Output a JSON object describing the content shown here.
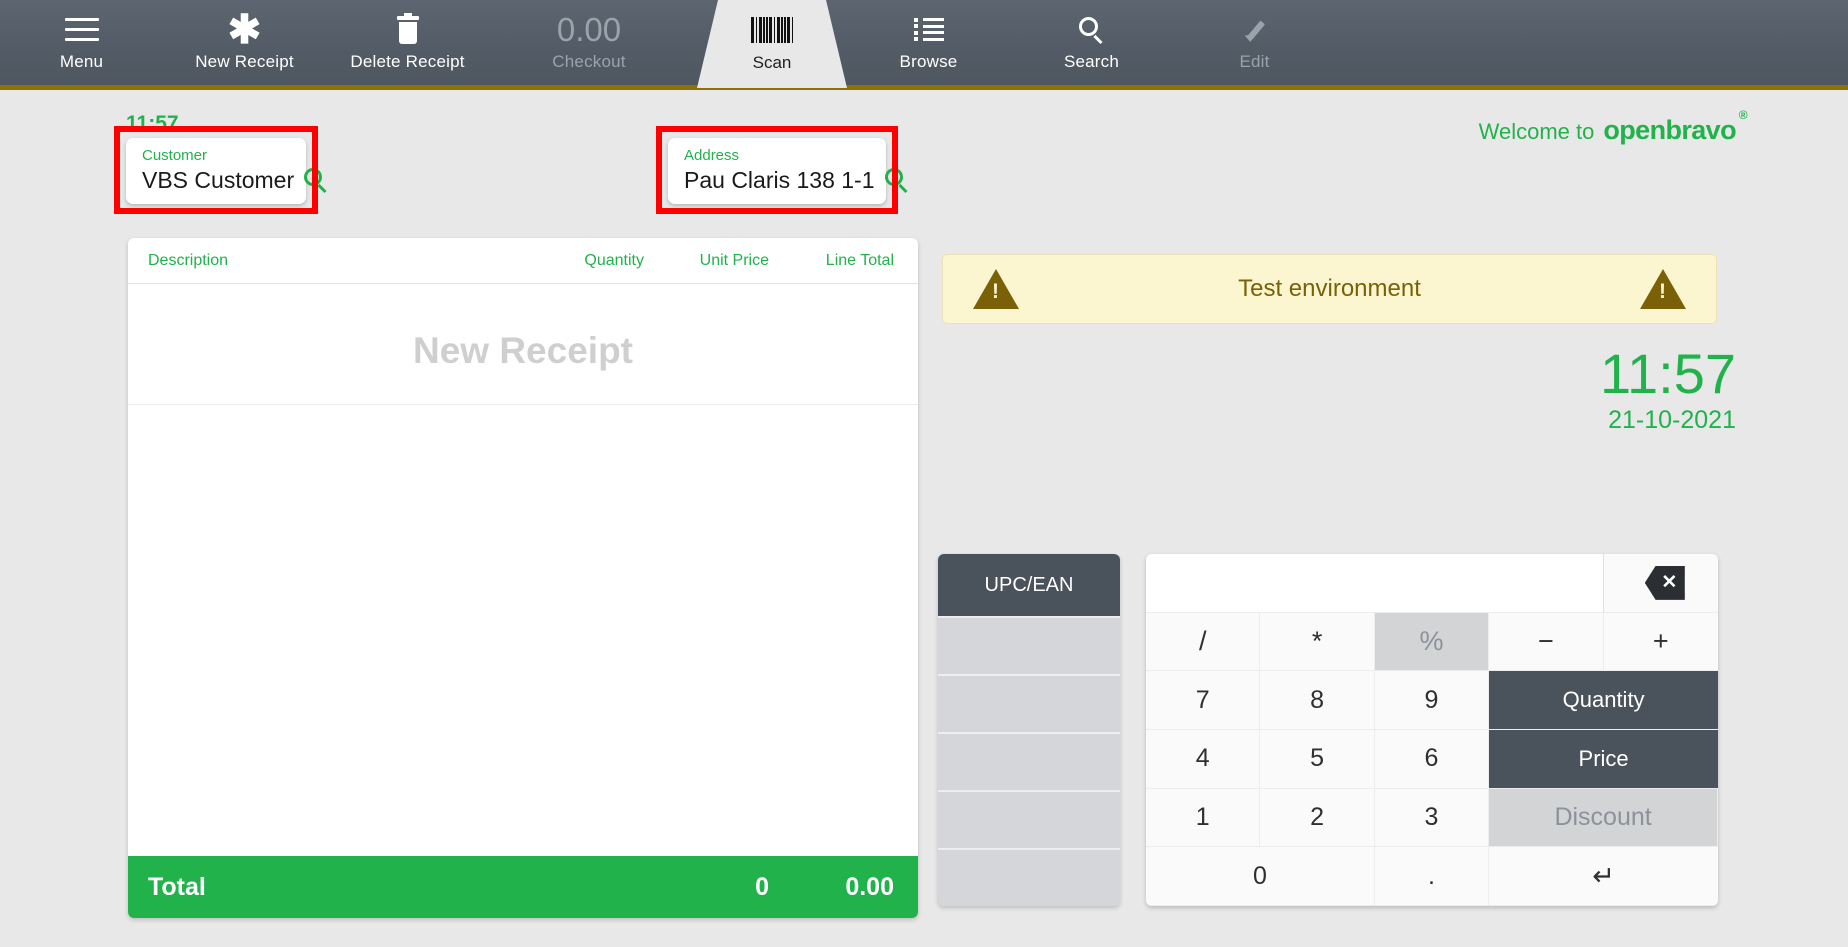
{
  "toolbar": {
    "items": [
      {
        "label": "Menu",
        "icon": "hamburger-menu-icon",
        "disabled": false
      },
      {
        "label": "New Receipt",
        "icon": "asterisk-icon",
        "disabled": false
      },
      {
        "label": "Delete Receipt",
        "icon": "trash-icon",
        "disabled": false
      },
      {
        "label": "Checkout",
        "icon": "amount-display",
        "amount": "0.00",
        "disabled": true
      },
      {
        "label": "Scan",
        "icon": "barcode-icon",
        "active": true
      },
      {
        "label": "Browse",
        "icon": "list-icon",
        "disabled": false
      },
      {
        "label": "Search",
        "icon": "magnifier-icon",
        "disabled": false
      },
      {
        "label": "Edit",
        "icon": "pencil-icon",
        "disabled": true
      }
    ],
    "checkout_amount": "0.00"
  },
  "status": {
    "time_small": "11:57"
  },
  "customer_field": {
    "label": "Customer",
    "value": "VBS Customer",
    "icon": "magnifier-icon"
  },
  "address_field": {
    "label": "Address",
    "value": "Pau Claris 138 1-1",
    "icon": "magnifier-icon"
  },
  "receipt": {
    "columns": {
      "description": "Description",
      "quantity": "Quantity",
      "unit_price": "Unit Price",
      "line_total": "Line Total"
    },
    "placeholder": "New Receipt",
    "total": {
      "label": "Total",
      "quantity": "0",
      "amount": "0.00"
    }
  },
  "branding": {
    "welcome_text": "Welcome to",
    "brand_name": "openbravo",
    "trademark": "®"
  },
  "banner": {
    "text": "Test environment",
    "icon": "warning-triangle-icon"
  },
  "clock": {
    "time": "11:57",
    "date": "21-10-2021"
  },
  "scan_panel": {
    "header": "UPC/EAN",
    "slots": [
      "",
      "",
      "",
      "",
      ""
    ]
  },
  "keypad": {
    "display_value": "",
    "backspace_icon": "backspace-icon",
    "keys": {
      "divide": "/",
      "multiply": "*",
      "percent": "%",
      "minus": "−",
      "plus": "+",
      "seven": "7",
      "eight": "8",
      "nine": "9",
      "four": "4",
      "five": "5",
      "six": "6",
      "one": "1",
      "two": "2",
      "three": "3",
      "zero": "0",
      "dot": ".",
      "enter": "↵",
      "quantity": "Quantity",
      "price": "Price",
      "discount": "Discount"
    }
  },
  "colors": {
    "accent_green": "#22b24c",
    "toolbar": "#535c66",
    "gold_line": "#8d7208",
    "dark_key": "#4a525b",
    "banner_bg": "#fbf6d0",
    "banner_fg": "#7a6108",
    "annotation_red": "#ff0000"
  }
}
